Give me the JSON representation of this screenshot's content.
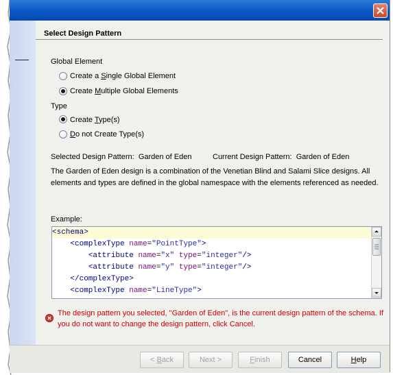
{
  "header": {
    "title": "Select Design Pattern"
  },
  "global_element": {
    "label": "Global Element",
    "options": [
      {
        "text_pre": "Create a ",
        "mnemonic": "S",
        "text_post": "ingle Global Element",
        "selected": false
      },
      {
        "text_pre": "Create ",
        "mnemonic": "M",
        "text_post": "ultiple Global Elements",
        "selected": true
      }
    ]
  },
  "type_group": {
    "label": "Type",
    "options": [
      {
        "text_pre": "Create ",
        "mnemonic": "T",
        "text_post": "ype(s)",
        "selected": true
      },
      {
        "text_pre": "",
        "mnemonic": "D",
        "text_post": "o not Create Type(s)",
        "selected": false
      }
    ]
  },
  "selected_pattern": {
    "label": "Selected Design Pattern:",
    "value": "Garden of Eden"
  },
  "current_pattern": {
    "label": "Current Design Pattern:",
    "value": "Garden of Eden"
  },
  "description": "The Garden of Eden design is a combination of the Venetian Blind and Salami Slice designs. All elements and types are defined in the global namespace with the elements referenced as needed.",
  "example": {
    "label": "Example:",
    "lines": [
      {
        "indent": "",
        "tag_open": "<schema>",
        "attrs": []
      },
      {
        "indent": "    ",
        "tag_open": "<complexType",
        "attrs": [
          {
            "name": "name",
            "value": "\"PointType\""
          }
        ],
        "tag_close": ">"
      },
      {
        "indent": "        ",
        "tag_open": "<attribute",
        "attrs": [
          {
            "name": "name",
            "value": "\"x\""
          },
          {
            "name": "type",
            "value": "\"integer\""
          }
        ],
        "tag_close": "/>"
      },
      {
        "indent": "        ",
        "tag_open": "<attribute",
        "attrs": [
          {
            "name": "name",
            "value": "\"y\""
          },
          {
            "name": "type",
            "value": "\"integer\""
          }
        ],
        "tag_close": "/>"
      },
      {
        "indent": "    ",
        "tag_open": "</complexType>",
        "attrs": []
      },
      {
        "indent": "    ",
        "tag_open": "<complexType",
        "attrs": [
          {
            "name": "name",
            "value": "\"LineType\""
          }
        ],
        "tag_close": ">"
      }
    ]
  },
  "error_message": "The design pattern you selected, \"Garden of Eden\", is the current design pattern of the schema. If you do not want to change the design pattern, click Cancel.",
  "buttons": {
    "back": {
      "pre": "< ",
      "mnemonic": "B",
      "post": "ack"
    },
    "next": {
      "label": "Next >"
    },
    "finish": {
      "pre": "",
      "mnemonic": "F",
      "post": "inish"
    },
    "cancel": {
      "label": "Cancel"
    },
    "help": {
      "pre": "",
      "mnemonic": "H",
      "post": "elp"
    }
  },
  "colors": {
    "titlebar": "#0a58c6",
    "error": "#cc0000",
    "highlight_line": "#fefcd6"
  }
}
